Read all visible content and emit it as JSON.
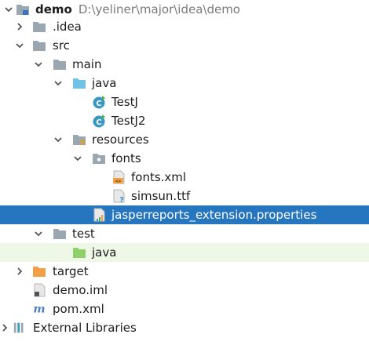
{
  "project_tree": {
    "root": {
      "name": "demo",
      "path": "D:\\yeliner\\major\\idea\\demo"
    },
    "nodes": [
      {
        "label": ".idea",
        "type": "folder"
      },
      {
        "label": "src",
        "type": "folder"
      },
      {
        "label": "main",
        "type": "folder"
      },
      {
        "label": "java",
        "type": "source-folder"
      },
      {
        "label": "TestJ",
        "type": "java-class"
      },
      {
        "label": "TestJ2",
        "type": "java-class"
      },
      {
        "label": "resources",
        "type": "resources-folder"
      },
      {
        "label": "fonts",
        "type": "package"
      },
      {
        "label": "fonts.xml",
        "type": "xml-file"
      },
      {
        "label": "simsun.ttf",
        "type": "unknown-file"
      },
      {
        "label": "jasperreports_extension.properties",
        "type": "properties-file",
        "selected": true
      },
      {
        "label": "test",
        "type": "folder"
      },
      {
        "label": "java",
        "type": "test-source-folder"
      },
      {
        "label": "target",
        "type": "excluded-folder"
      },
      {
        "label": "demo.iml",
        "type": "iml-file"
      },
      {
        "label": "pom.xml",
        "type": "maven-file"
      },
      {
        "label": "External Libraries",
        "type": "libraries"
      }
    ]
  },
  "colors": {
    "selection": "#2675bf",
    "folder": "#9aa7b0",
    "source_folder": "#6fc3e8",
    "test_source_folder": "#8ed16a",
    "excluded_folder": "#f2a048",
    "java_class": "#3a98c3",
    "maven": "#4e7fc6"
  }
}
